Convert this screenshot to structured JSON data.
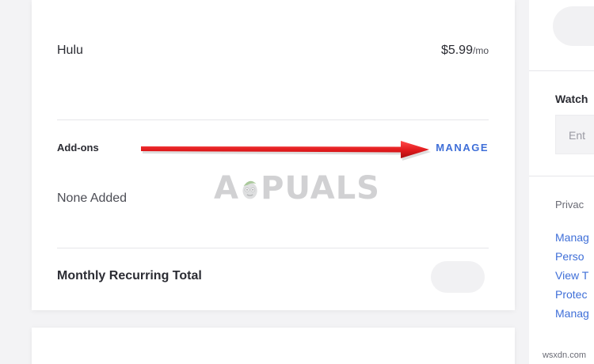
{
  "subscription": {
    "plan_name": "Hulu",
    "plan_price": "$5.99",
    "plan_price_period": "/mo",
    "addons_label": "Add-ons",
    "manage_label": "MANAGE",
    "addons_status": "None Added",
    "total_label": "Monthly Recurring Total"
  },
  "right_panel": {
    "watch_label": "Watch",
    "input_placeholder": "Ent",
    "privacy_label": "Privac",
    "links": [
      "Manag",
      "Perso",
      "View T",
      "Protec",
      "Manag"
    ]
  },
  "overlay": {
    "watermark_left": "A",
    "watermark_right": "PUALS",
    "arrow_color": "#e0191c"
  },
  "site_credit": "wsxdn.com",
  "colors": {
    "accent_link": "#3f6fd8",
    "background": "#f3f3f5",
    "card": "#ffffff"
  }
}
